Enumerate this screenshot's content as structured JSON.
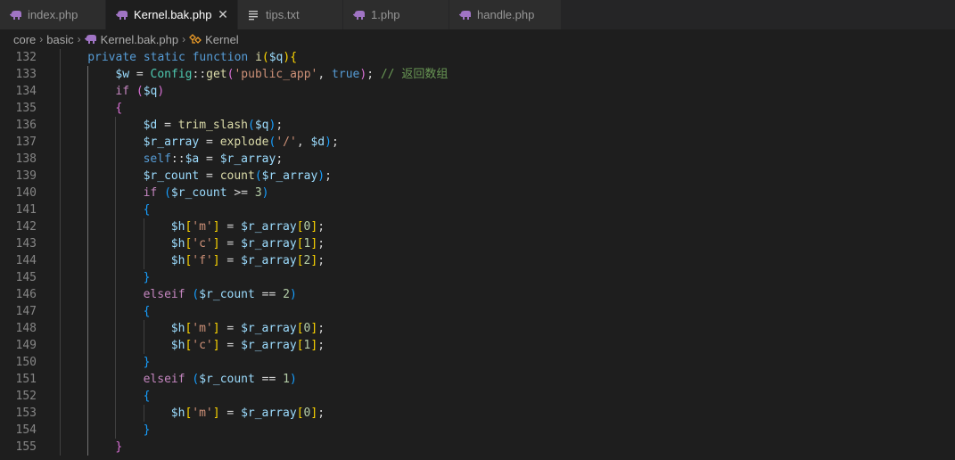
{
  "tabs": [
    {
      "label": "index.php",
      "icon": "php-elephant-icon",
      "active": false,
      "width": 119
    },
    {
      "label": "Kernel.bak.php",
      "icon": "php-elephant-icon",
      "active": true,
      "close": "✕",
      "width": 148
    },
    {
      "label": "tips.txt",
      "icon": "text-lines-icon",
      "active": false,
      "width": 118
    },
    {
      "label": "1.php",
      "icon": "php-elephant-icon",
      "active": false,
      "width": 119
    },
    {
      "label": "handle.php",
      "icon": "php-elephant-icon",
      "active": false,
      "width": 126
    }
  ],
  "breadcrumb": {
    "items": [
      "core",
      "basic",
      "Kernel.bak.php",
      "Kernel"
    ],
    "separator": "›"
  },
  "colors": {
    "php_icon": "#a074c4",
    "class_icon": "#ee9d28",
    "keyword": "#569cd6",
    "control": "#c586c0",
    "variable": "#9cdcfe",
    "function": "#dcdcaa",
    "class": "#4ec9b0",
    "string": "#ce9178",
    "number": "#b5cea8",
    "comment": "#6a9955"
  },
  "editor": {
    "lines": [
      {
        "n": "132",
        "indent": 1,
        "tokens": [
          [
            "kw",
            "private"
          ],
          [
            "p",
            " "
          ],
          [
            "kw",
            "static"
          ],
          [
            "p",
            " "
          ],
          [
            "kw",
            "function"
          ],
          [
            "p",
            " "
          ],
          [
            "fn",
            "i"
          ],
          [
            "b1",
            "("
          ],
          [
            "var",
            "$q"
          ],
          [
            "b1",
            ")"
          ],
          [
            "b1",
            "{"
          ]
        ]
      },
      {
        "n": "133",
        "indent": 2,
        "tokens": [
          [
            "var",
            "$w"
          ],
          [
            "p",
            " = "
          ],
          [
            "cls",
            "Config"
          ],
          [
            "p",
            "::"
          ],
          [
            "fn",
            "get"
          ],
          [
            "b2",
            "("
          ],
          [
            "str",
            "'public_app'"
          ],
          [
            "p",
            ", "
          ],
          [
            "kw",
            "true"
          ],
          [
            "b2",
            ")"
          ],
          [
            "p",
            "; "
          ],
          [
            "cmt",
            "// 返回数组"
          ]
        ]
      },
      {
        "n": "134",
        "indent": 2,
        "tokens": [
          [
            "ctl",
            "if"
          ],
          [
            "p",
            " "
          ],
          [
            "b2",
            "("
          ],
          [
            "var",
            "$q"
          ],
          [
            "b2",
            ")"
          ]
        ]
      },
      {
        "n": "135",
        "indent": 2,
        "tokens": [
          [
            "b2",
            "{"
          ]
        ]
      },
      {
        "n": "136",
        "indent": 3,
        "tokens": [
          [
            "var",
            "$d"
          ],
          [
            "p",
            " = "
          ],
          [
            "fn",
            "trim_slash"
          ],
          [
            "b3",
            "("
          ],
          [
            "var",
            "$q"
          ],
          [
            "b3",
            ")"
          ],
          [
            "p",
            ";"
          ]
        ]
      },
      {
        "n": "137",
        "indent": 3,
        "tokens": [
          [
            "var",
            "$r_array"
          ],
          [
            "p",
            " = "
          ],
          [
            "fn",
            "explode"
          ],
          [
            "b3",
            "("
          ],
          [
            "str",
            "'/'"
          ],
          [
            "p",
            ", "
          ],
          [
            "var",
            "$d"
          ],
          [
            "b3",
            ")"
          ],
          [
            "p",
            ";"
          ]
        ]
      },
      {
        "n": "138",
        "indent": 3,
        "tokens": [
          [
            "kw",
            "self"
          ],
          [
            "p",
            "::"
          ],
          [
            "var",
            "$a"
          ],
          [
            "p",
            " = "
          ],
          [
            "var",
            "$r_array"
          ],
          [
            "p",
            ";"
          ]
        ]
      },
      {
        "n": "139",
        "indent": 3,
        "tokens": [
          [
            "var",
            "$r_count"
          ],
          [
            "p",
            " = "
          ],
          [
            "fn",
            "count"
          ],
          [
            "b3",
            "("
          ],
          [
            "var",
            "$r_array"
          ],
          [
            "b3",
            ")"
          ],
          [
            "p",
            ";"
          ]
        ]
      },
      {
        "n": "140",
        "indent": 3,
        "tokens": [
          [
            "ctl",
            "if"
          ],
          [
            "p",
            " "
          ],
          [
            "b3",
            "("
          ],
          [
            "var",
            "$r_count"
          ],
          [
            "p",
            " >= "
          ],
          [
            "num",
            "3"
          ],
          [
            "b3",
            ")"
          ]
        ]
      },
      {
        "n": "141",
        "indent": 3,
        "tokens": [
          [
            "b3",
            "{"
          ]
        ]
      },
      {
        "n": "142",
        "indent": 4,
        "tokens": [
          [
            "var",
            "$h"
          ],
          [
            "b1",
            "["
          ],
          [
            "str",
            "'m'"
          ],
          [
            "b1",
            "]"
          ],
          [
            "p",
            " = "
          ],
          [
            "var",
            "$r_array"
          ],
          [
            "b1",
            "["
          ],
          [
            "num",
            "0"
          ],
          [
            "b1",
            "]"
          ],
          [
            "p",
            ";"
          ]
        ]
      },
      {
        "n": "143",
        "indent": 4,
        "tokens": [
          [
            "var",
            "$h"
          ],
          [
            "b1",
            "["
          ],
          [
            "str",
            "'c'"
          ],
          [
            "b1",
            "]"
          ],
          [
            "p",
            " = "
          ],
          [
            "var",
            "$r_array"
          ],
          [
            "b1",
            "["
          ],
          [
            "num",
            "1"
          ],
          [
            "b1",
            "]"
          ],
          [
            "p",
            ";"
          ]
        ]
      },
      {
        "n": "144",
        "indent": 4,
        "tokens": [
          [
            "var",
            "$h"
          ],
          [
            "b1",
            "["
          ],
          [
            "str",
            "'f'"
          ],
          [
            "b1",
            "]"
          ],
          [
            "p",
            " = "
          ],
          [
            "var",
            "$r_array"
          ],
          [
            "b1",
            "["
          ],
          [
            "num",
            "2"
          ],
          [
            "b1",
            "]"
          ],
          [
            "p",
            ";"
          ]
        ]
      },
      {
        "n": "145",
        "indent": 3,
        "tokens": [
          [
            "b3",
            "}"
          ]
        ]
      },
      {
        "n": "146",
        "indent": 3,
        "tokens": [
          [
            "ctl",
            "elseif"
          ],
          [
            "p",
            " "
          ],
          [
            "b3",
            "("
          ],
          [
            "var",
            "$r_count"
          ],
          [
            "p",
            " == "
          ],
          [
            "num",
            "2"
          ],
          [
            "b3",
            ")"
          ]
        ]
      },
      {
        "n": "147",
        "indent": 3,
        "tokens": [
          [
            "b3",
            "{"
          ]
        ]
      },
      {
        "n": "148",
        "indent": 4,
        "tokens": [
          [
            "var",
            "$h"
          ],
          [
            "b1",
            "["
          ],
          [
            "str",
            "'m'"
          ],
          [
            "b1",
            "]"
          ],
          [
            "p",
            " = "
          ],
          [
            "var",
            "$r_array"
          ],
          [
            "b1",
            "["
          ],
          [
            "num",
            "0"
          ],
          [
            "b1",
            "]"
          ],
          [
            "p",
            ";"
          ]
        ]
      },
      {
        "n": "149",
        "indent": 4,
        "tokens": [
          [
            "var",
            "$h"
          ],
          [
            "b1",
            "["
          ],
          [
            "str",
            "'c'"
          ],
          [
            "b1",
            "]"
          ],
          [
            "p",
            " = "
          ],
          [
            "var",
            "$r_array"
          ],
          [
            "b1",
            "["
          ],
          [
            "num",
            "1"
          ],
          [
            "b1",
            "]"
          ],
          [
            "p",
            ";"
          ]
        ]
      },
      {
        "n": "150",
        "indent": 3,
        "tokens": [
          [
            "b3",
            "}"
          ]
        ]
      },
      {
        "n": "151",
        "indent": 3,
        "tokens": [
          [
            "ctl",
            "elseif"
          ],
          [
            "p",
            " "
          ],
          [
            "b3",
            "("
          ],
          [
            "var",
            "$r_count"
          ],
          [
            "p",
            " == "
          ],
          [
            "num",
            "1"
          ],
          [
            "b3",
            ")"
          ]
        ]
      },
      {
        "n": "152",
        "indent": 3,
        "tokens": [
          [
            "b3",
            "{"
          ]
        ]
      },
      {
        "n": "153",
        "indent": 4,
        "tokens": [
          [
            "var",
            "$h"
          ],
          [
            "b1",
            "["
          ],
          [
            "str",
            "'m'"
          ],
          [
            "b1",
            "]"
          ],
          [
            "p",
            " = "
          ],
          [
            "var",
            "$r_array"
          ],
          [
            "b1",
            "["
          ],
          [
            "num",
            "0"
          ],
          [
            "b1",
            "]"
          ],
          [
            "p",
            ";"
          ]
        ]
      },
      {
        "n": "154",
        "indent": 3,
        "tokens": [
          [
            "b3",
            "}"
          ]
        ]
      },
      {
        "n": "155",
        "indent": 2,
        "tokens": [
          [
            "b2",
            "}"
          ]
        ]
      }
    ]
  }
}
